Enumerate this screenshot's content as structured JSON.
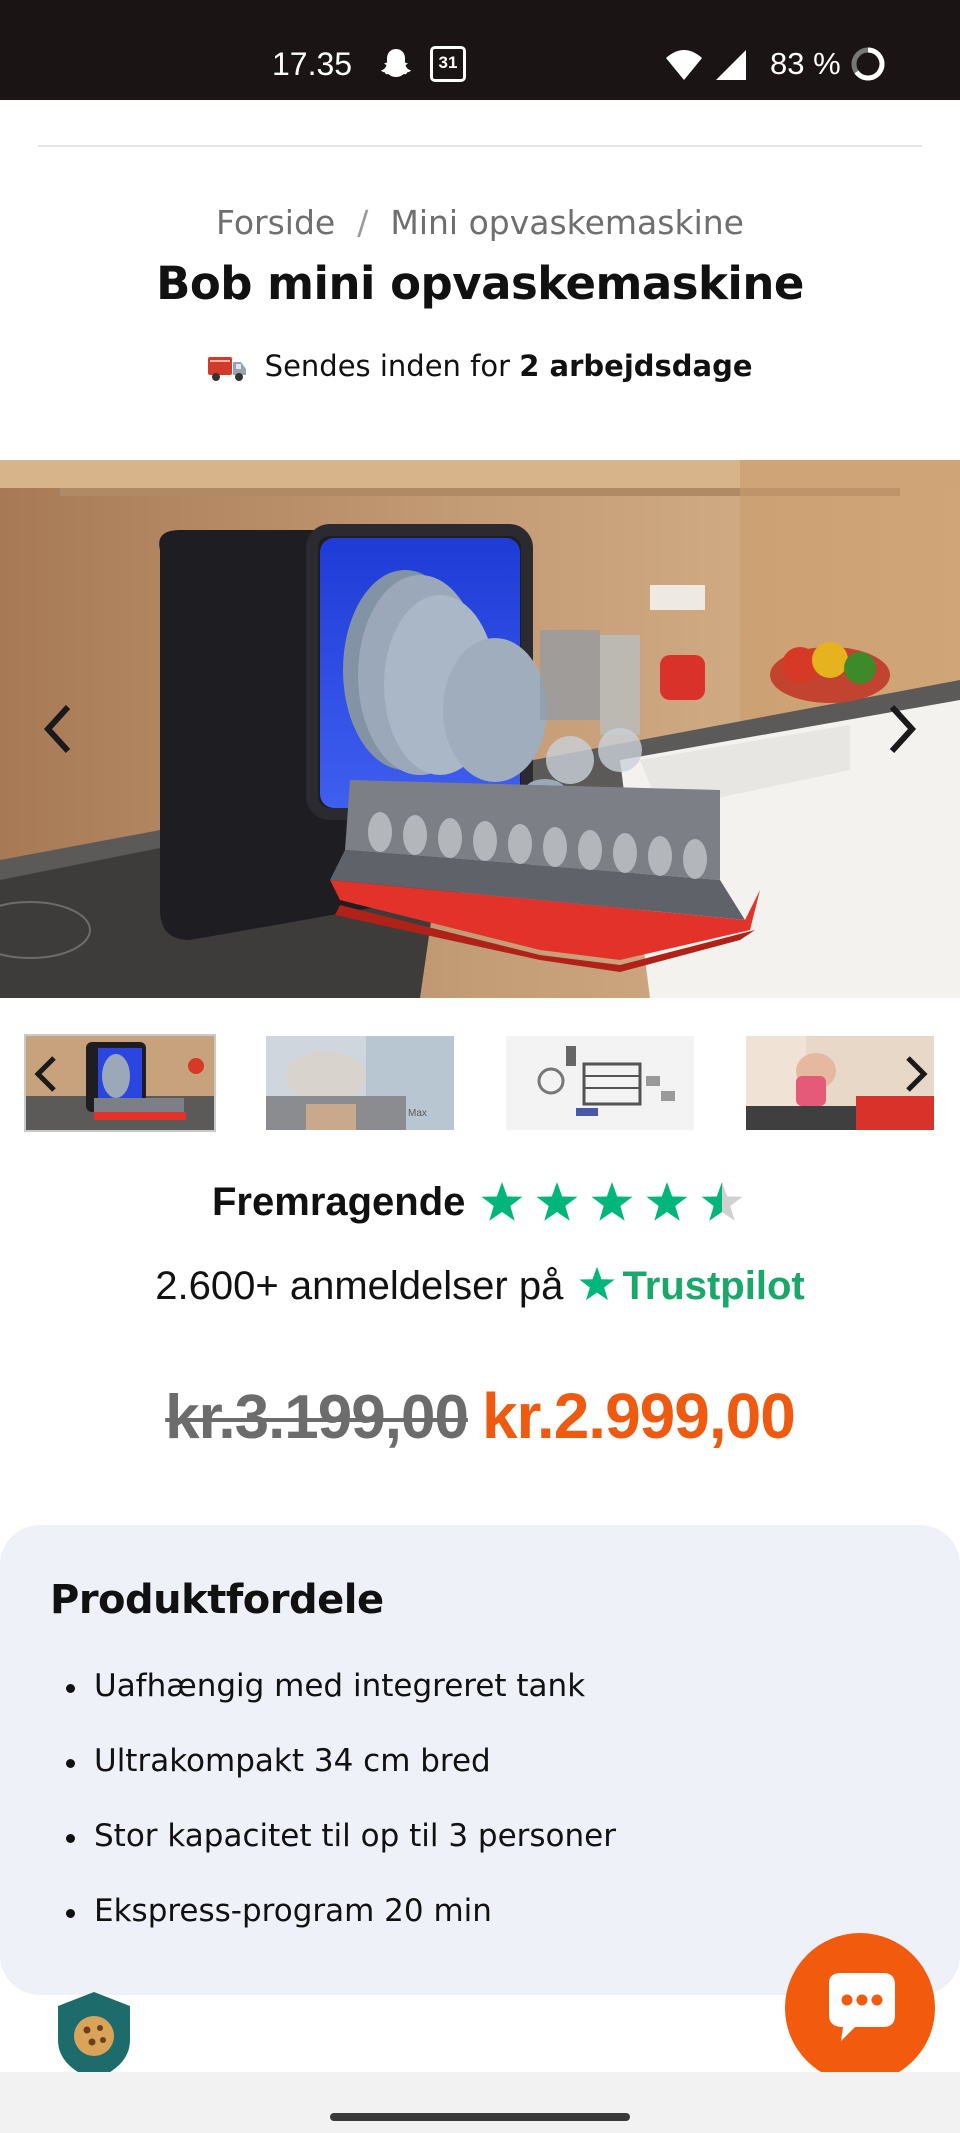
{
  "status_bar": {
    "time": "17.35",
    "calendar_day": "31",
    "battery": "83 %",
    "icons": [
      "snapchat-icon",
      "calendar-icon",
      "wifi-icon",
      "signal-icon",
      "battery-icon"
    ]
  },
  "breadcrumb": {
    "home": "Forside",
    "separator": "/",
    "current": "Mini opvaskemaskine"
  },
  "product": {
    "title": "Bob mini opvaskemaskine",
    "shipping_prefix": "Sendes inden for",
    "shipping_bold": "2 arbejdsdage"
  },
  "gallery": {
    "thumbnail_count": 4,
    "active_index": 0,
    "thumb2_caption": "Max"
  },
  "rating": {
    "label": "Fremragende",
    "stars": 4.5,
    "reviews_prefix": "2.600+ anmeldelser på",
    "trustpilot": "Trustpilot"
  },
  "price": {
    "old": "kr.3.199,00",
    "new": "kr.2.999,00"
  },
  "benefits": {
    "heading": "Produktfordele",
    "items": [
      "Uafhængig med integreret tank",
      "Ultrakompakt 34 cm bred",
      "Stor kapacitet til op til 3 personer",
      "Ekspress-program 20 min"
    ]
  },
  "colors": {
    "accent": "#ee5a10",
    "trustpilot_green": "#00b67a",
    "card_bg": "#eef1f8",
    "status_bar": "#1b1414"
  }
}
